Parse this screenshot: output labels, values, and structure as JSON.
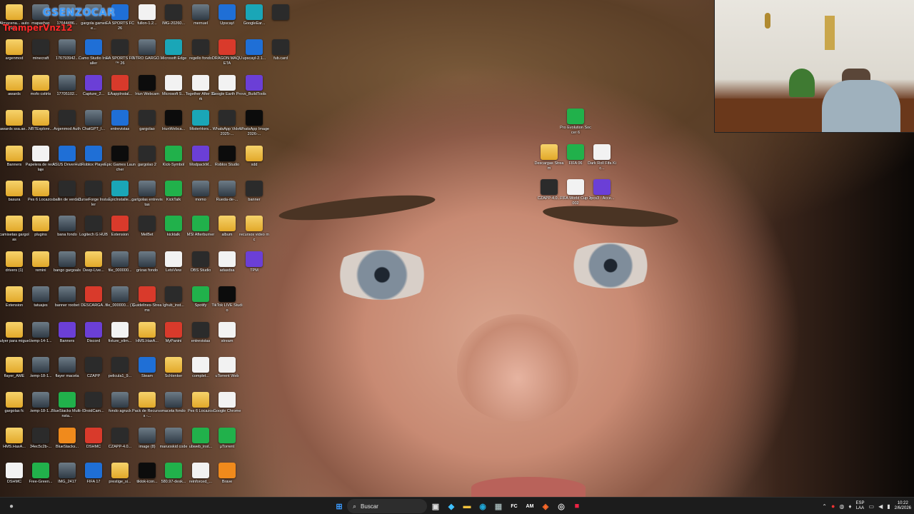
{
  "overlay": {
    "title": "GSENZOCAR",
    "username": "TramperVnz12"
  },
  "desktop_icons": [
    {
      "label": "Almacena... automátic...",
      "icon": "folder-icon",
      "style": "g-folder"
    },
    {
      "label": "argenmod",
      "icon": "folder-icon",
      "style": "g-folder"
    },
    {
      "label": "awards",
      "icon": "folder-icon",
      "style": "g-folder"
    },
    {
      "label": "awards ssa.ae...",
      "icon": "folder-icon",
      "style": "g-folder"
    },
    {
      "label": "Banners",
      "icon": "folder-icon",
      "style": "g-folder"
    },
    {
      "label": "basura",
      "icon": "folder-icon",
      "style": "g-folder"
    },
    {
      "label": "camisetas gargolas",
      "icon": "folder-icon",
      "style": "g-folder"
    },
    {
      "label": "drivers (1)",
      "icon": "folder-icon",
      "style": "g-folder"
    },
    {
      "label": "Extension",
      "icon": "folder-icon",
      "style": "g-folder"
    },
    {
      "label": "fulyer para miguel",
      "icon": "folder-icon",
      "style": "g-folder"
    },
    {
      "label": "flayer_AME",
      "icon": "folder-icon",
      "style": "g-folder"
    },
    {
      "label": "gargolas fc",
      "icon": "folder-icon",
      "style": "g-folder"
    },
    {
      "label": "HMS.HaxA...",
      "icon": "folder-icon",
      "style": "g-folder"
    },
    {
      "label": "DSHMC",
      "icon": "document-icon",
      "style": "g-white"
    },
    {
      "label": "mapashax",
      "icon": "image-icon",
      "style": "g-img"
    },
    {
      "label": "minecraft",
      "icon": "folder-icon",
      "style": "g-dark"
    },
    {
      "label": "mofo csttrts",
      "icon": "folder-icon",
      "style": "g-folder"
    },
    {
      "label": "NBTExplore...",
      "icon": "folder-icon",
      "style": "g-folder"
    },
    {
      "label": "Papelera de reciclaje",
      "icon": "recycle-bin-icon",
      "style": "g-white"
    },
    {
      "label": "Pes 6 Locazos",
      "icon": "folder-icon",
      "style": "g-folder"
    },
    {
      "label": "plugins",
      "icon": "folder-icon",
      "style": "g-folder"
    },
    {
      "label": "remini",
      "icon": "folder-icon",
      "style": "g-folder"
    },
    {
      "label": "tatuajes",
      "icon": "image-icon",
      "style": "g-img"
    },
    {
      "label": ".temp-14-1...",
      "icon": "image-icon",
      "style": "g-img"
    },
    {
      "label": ".temp-18-1...",
      "icon": "image-icon",
      "style": "g-img"
    },
    {
      "label": ".temp-18-1...",
      "icon": "image-icon",
      "style": "g-img"
    },
    {
      "label": "34ec5c2b-...",
      "icon": "image-icon",
      "style": "g-dark"
    },
    {
      "label": "Free-Green...",
      "icon": "image-icon",
      "style": "g-green"
    },
    {
      "label": "17644486...",
      "icon": "image-icon",
      "style": "g-img"
    },
    {
      "label": "176793942...",
      "icon": "image-icon",
      "style": "g-img"
    },
    {
      "label": "17705102...",
      "icon": "image-icon",
      "style": "g-img"
    },
    {
      "label": "Argenmod Auth",
      "icon": "app-icon",
      "style": "g-dark"
    },
    {
      "label": "ASUS DriverHub",
      "icon": "app-icon",
      "style": "g-blue"
    },
    {
      "label": "ballin de verdad",
      "icon": "image-icon",
      "style": "g-dark"
    },
    {
      "label": "bana fondo",
      "icon": "image-icon",
      "style": "g-img"
    },
    {
      "label": "bango gargoals",
      "icon": "image-icon",
      "style": "g-img"
    },
    {
      "label": "banner roobet",
      "icon": "image-icon",
      "style": "g-img"
    },
    {
      "label": "Banners",
      "icon": "archive-icon",
      "style": "g-purple"
    },
    {
      "label": "flayer maceta",
      "icon": "image-icon",
      "style": "g-img"
    },
    {
      "label": "BlueStacks Multi-Insta...",
      "icon": "app-icon",
      "style": "g-green"
    },
    {
      "label": "BlueStacks...",
      "icon": "app-icon",
      "style": "g-orange"
    },
    {
      "label": "IMG_2417",
      "icon": "image-icon",
      "style": "g-img"
    },
    {
      "label": "gargola gamer e...",
      "icon": "image-icon",
      "style": "g-img"
    },
    {
      "label": "Camo Studio Installer",
      "icon": "app-icon",
      "style": "g-blue"
    },
    {
      "label": "Capture_2...",
      "icon": "app-icon",
      "style": "g-purple"
    },
    {
      "label": "ChatGPT_I...",
      "icon": "image-icon",
      "style": "g-img"
    },
    {
      "label": "Roblox Player",
      "icon": "app-icon",
      "style": "g-blue"
    },
    {
      "label": "CurseForge Installer",
      "icon": "app-icon",
      "style": "g-dark"
    },
    {
      "label": "Logitech G HUB",
      "icon": "app-icon",
      "style": "g-dark"
    },
    {
      "label": "Deep-Live...",
      "icon": "folder-icon",
      "style": "g-folder"
    },
    {
      "label": "DESCARGA...",
      "icon": "pdf-icon",
      "style": "g-red"
    },
    {
      "label": "Discord",
      "icon": "discord-icon",
      "style": "g-purple"
    },
    {
      "label": "CZAPP",
      "icon": "image-icon",
      "style": "g-dark"
    },
    {
      "label": "DroidCam...",
      "icon": "app-icon",
      "style": "g-dark"
    },
    {
      "label": "DSHMC",
      "icon": "app-icon",
      "style": "g-red"
    },
    {
      "label": "FIFA 17",
      "icon": "app-icon",
      "style": "g-blue"
    },
    {
      "label": "EA SPORTS FC 26",
      "icon": "app-icon",
      "style": "g-blue"
    },
    {
      "label": "EA SPORTS FC™ 26",
      "icon": "app-icon",
      "style": "g-dark"
    },
    {
      "label": "EAappInstal...",
      "icon": "app-icon",
      "style": "g-red"
    },
    {
      "label": "entrevistas",
      "icon": "image-icon",
      "style": "g-blue"
    },
    {
      "label": "Epic Games Launcher",
      "icon": "app-icon",
      "style": "g-black"
    },
    {
      "label": "EpicInstalle...",
      "icon": "app-icon",
      "style": "g-teal"
    },
    {
      "label": "Extension",
      "icon": "archive-icon",
      "style": "g-red"
    },
    {
      "label": "file_000000...",
      "icon": "image-icon",
      "style": "g-img"
    },
    {
      "label": "file_000000... (1)",
      "icon": "image-icon",
      "style": "g-img"
    },
    {
      "label": "fixture_elim...",
      "icon": "document-icon",
      "style": "g-white"
    },
    {
      "label": "pelicula1_9...",
      "icon": "image-icon",
      "style": "g-dark"
    },
    {
      "label": "fondo agruck",
      "icon": "image-icon",
      "style": "g-img"
    },
    {
      "label": "CZAPP-4.0...",
      "icon": "app-icon",
      "style": "g-dark"
    },
    {
      "label": "prestige_si...",
      "icon": "folder-icon",
      "style": "g-folder"
    },
    {
      "label": "fullon-1.2...",
      "icon": "app-icon",
      "style": "g-white"
    },
    {
      "label": "INTRO GARGO...",
      "icon": "image-icon",
      "style": "g-img"
    },
    {
      "label": "Iriun Webcam",
      "icon": "app-icon",
      "style": "g-black"
    },
    {
      "label": "gargolao",
      "icon": "image-icon",
      "style": "g-dark"
    },
    {
      "label": "gargolao 2",
      "icon": "image-icon",
      "style": "g-dark"
    },
    {
      "label": "gartgolas entrevistas",
      "icon": "image-icon",
      "style": "g-img"
    },
    {
      "label": "MelBet",
      "icon": "app-icon",
      "style": "g-dark"
    },
    {
      "label": "grizas fondo",
      "icon": "image-icon",
      "style": "g-img"
    },
    {
      "label": "Guidelines-Streams",
      "icon": "pdf-icon",
      "style": "g-red"
    },
    {
      "label": "HMS.HaxA...",
      "icon": "folder-icon",
      "style": "g-folder"
    },
    {
      "label": "Steam",
      "icon": "steam-icon",
      "style": "g-blue"
    },
    {
      "label": "Pack de Recursos -...",
      "icon": "folder-icon",
      "style": "g-folder"
    },
    {
      "label": "image (8)",
      "icon": "image-icon",
      "style": "g-img"
    },
    {
      "label": "tiktok-icon...",
      "icon": "tiktok-icon",
      "style": "g-black"
    },
    {
      "label": "IMG-20260...",
      "icon": "image-icon",
      "style": "g-dark"
    },
    {
      "label": "Microsoft Edge",
      "icon": "edge-icon",
      "style": "g-teal"
    },
    {
      "label": "Microsoft S...",
      "icon": "document-icon",
      "style": "g-white"
    },
    {
      "label": "IriunWebca...",
      "icon": "app-icon",
      "style": "g-black"
    },
    {
      "label": "Kick-Symbol",
      "icon": "app-icon",
      "style": "g-green"
    },
    {
      "label": "KickTalk",
      "icon": "app-icon",
      "style": "g-green"
    },
    {
      "label": "kicktalk",
      "icon": "app-icon",
      "style": "g-green"
    },
    {
      "label": "LetsView",
      "icon": "app-icon",
      "style": "g-white"
    },
    {
      "label": "lghub_inst...",
      "icon": "app-icon",
      "style": "g-dark"
    },
    {
      "label": "MyPanini",
      "icon": "app-icon",
      "style": "g-red"
    },
    {
      "label": "Schlenker",
      "icon": "folder-icon",
      "style": "g-folder"
    },
    {
      "label": "maceta fondo",
      "icon": "image-icon",
      "style": "g-img"
    },
    {
      "label": "maruoskid code",
      "icon": "image-icon",
      "style": "g-img"
    },
    {
      "label": "580.97-desk...",
      "icon": "app-icon",
      "style": "g-green"
    },
    {
      "label": "mernuel",
      "icon": "image-icon",
      "style": "g-img"
    },
    {
      "label": "regello fondo",
      "icon": "image-icon",
      "style": "g-dark"
    },
    {
      "label": "Together After Dark",
      "icon": "document-icon",
      "style": "g-white"
    },
    {
      "label": "MisterHors...",
      "icon": "app-icon",
      "style": "g-teal"
    },
    {
      "label": "ModpackM...",
      "icon": "archive-icon",
      "style": "g-purple"
    },
    {
      "label": "momo",
      "icon": "image-icon",
      "style": "g-img"
    },
    {
      "label": "MSI Afterburner",
      "icon": "app-icon",
      "style": "g-green"
    },
    {
      "label": "OBS Studio",
      "icon": "obs-icon",
      "style": "g-dark"
    },
    {
      "label": "Spotify",
      "icon": "spotify-icon",
      "style": "g-green"
    },
    {
      "label": "entrevistas",
      "icon": "image-icon",
      "style": "g-dark"
    },
    {
      "label": "complet...",
      "icon": "document-icon",
      "style": "g-white"
    },
    {
      "label": "Pes 6 Locazos",
      "icon": "folder-icon",
      "style": "g-folder"
    },
    {
      "label": "ubweb_inst...",
      "icon": "app-icon",
      "style": "g-green"
    },
    {
      "label": "reinforced_...",
      "icon": "app-icon",
      "style": "g-white"
    },
    {
      "label": "Upscayl",
      "icon": "app-icon",
      "style": "g-blue"
    },
    {
      "label": "DRAGON MAQUETA",
      "icon": "pdf-icon",
      "style": "g-red"
    },
    {
      "label": "Google Earth Pro",
      "icon": "app-icon",
      "style": "g-white"
    },
    {
      "label": "WhatsApp Video 2025-...",
      "icon": "image-icon",
      "style": "g-dark"
    },
    {
      "label": "Roblox Studio",
      "icon": "app-icon",
      "style": "g-black"
    },
    {
      "label": "Rueda-de-...",
      "icon": "image-icon",
      "style": "g-img"
    },
    {
      "label": "album",
      "icon": "folder-icon",
      "style": "g-folder"
    },
    {
      "label": "adasdsa",
      "icon": "document-icon",
      "style": "g-white"
    },
    {
      "label": "TikTok LIVE Studio",
      "icon": "tiktok-icon",
      "style": "g-black"
    },
    {
      "label": "stream",
      "icon": "document-icon",
      "style": "g-white"
    },
    {
      "label": "uTorrent Web",
      "icon": "document-icon",
      "style": "g-white"
    },
    {
      "label": "Google Chrome",
      "icon": "chrome-icon",
      "style": "g-white"
    },
    {
      "label": "µTorrent",
      "icon": "utorrent-icon",
      "style": "g-green"
    },
    {
      "label": "Brave",
      "icon": "brave-icon",
      "style": "g-orange"
    },
    {
      "label": "GoogleEar...",
      "icon": "app-icon",
      "style": "g-teal"
    },
    {
      "label": "upscayl-2.1...",
      "icon": "app-icon",
      "style": "g-blue"
    },
    {
      "label": "vs_BuildTools",
      "icon": "app-icon",
      "style": "g-purple"
    },
    {
      "label": "WhatsApp Image 2026-...",
      "icon": "image-icon",
      "style": "g-black"
    },
    {
      "label": "xdd",
      "icon": "folder-icon",
      "style": "g-folder"
    },
    {
      "label": "banner",
      "icon": "image-icon",
      "style": "g-dark"
    },
    {
      "label": "recursos video mc",
      "icon": "folder-icon",
      "style": "g-folder"
    },
    {
      "label": "TPM",
      "icon": "archive-icon",
      "style": "g-purple"
    },
    {
      "label": "",
      "icon": "app-icon",
      "style": "g-dark"
    },
    {
      "label": "fub.card",
      "icon": "app-icon",
      "style": "g-dark"
    }
  ],
  "right_icons": [
    {
      "label": "Pro Evolution Soccer 6",
      "icon": "app-icon",
      "style": "g-green"
    },
    {
      "label": "Descargas Stream",
      "icon": "folder-icon",
      "style": "g-folder"
    },
    {
      "label": "FIFA 06",
      "icon": "app-icon",
      "style": "g-green"
    },
    {
      "label": "Dark Roll Fifa Kic...",
      "icon": "app-icon",
      "style": "g-white"
    },
    {
      "label": "CZAPP-4.0...",
      "icon": "app-icon",
      "style": "g-dark"
    },
    {
      "label": "FIFA World Cup 2002",
      "icon": "app-icon",
      "style": "g-white"
    },
    {
      "label": "rpcs3 - Acce...",
      "icon": "app-icon",
      "style": "g-purple"
    }
  ],
  "taskbar": {
    "search_placeholder": "Buscar",
    "pinned": [
      {
        "name": "start-button",
        "glyph": "⊞",
        "color": "#3b9bff"
      },
      {
        "name": "task-view-button",
        "glyph": "▣",
        "color": "#ddd"
      },
      {
        "name": "copilot-icon",
        "glyph": "◆",
        "color": "#40c0ff"
      },
      {
        "name": "file-explorer-icon",
        "glyph": "▬",
        "color": "#f2c23d"
      },
      {
        "name": "edge-icon",
        "glyph": "◉",
        "color": "#1fa6d6"
      },
      {
        "name": "calculator-icon",
        "glyph": "▦",
        "color": "#9aa"
      },
      {
        "name": "fc-icon",
        "glyph": "FC",
        "color": "#fff"
      },
      {
        "name": "ame-icon",
        "glyph": "AM",
        "color": "#fff"
      },
      {
        "name": "brave-icon",
        "glyph": "◈",
        "color": "#ff6a2a"
      },
      {
        "name": "obs-icon",
        "glyph": "◎",
        "color": "#ddd"
      },
      {
        "name": "app-icon",
        "glyph": "■",
        "color": "#e24"
      }
    ],
    "lang_top": "ESP",
    "lang_bottom": "LAA",
    "time": "10:22",
    "date": "2/6/2026"
  }
}
